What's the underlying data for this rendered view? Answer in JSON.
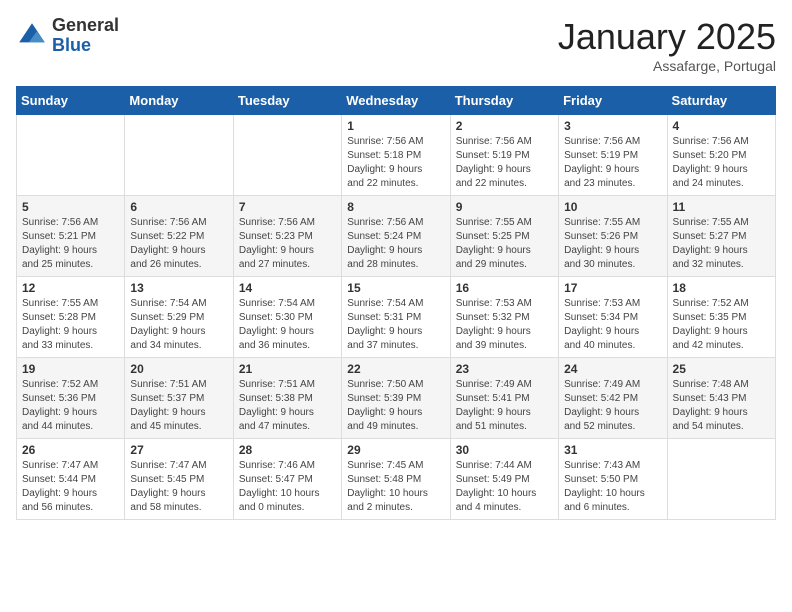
{
  "header": {
    "logo_general": "General",
    "logo_blue": "Blue",
    "month_title": "January 2025",
    "location": "Assafarge, Portugal"
  },
  "weekdays": [
    "Sunday",
    "Monday",
    "Tuesday",
    "Wednesday",
    "Thursday",
    "Friday",
    "Saturday"
  ],
  "weeks": [
    [
      {
        "day": "",
        "info": ""
      },
      {
        "day": "",
        "info": ""
      },
      {
        "day": "",
        "info": ""
      },
      {
        "day": "1",
        "info": "Sunrise: 7:56 AM\nSunset: 5:18 PM\nDaylight: 9 hours\nand 22 minutes."
      },
      {
        "day": "2",
        "info": "Sunrise: 7:56 AM\nSunset: 5:19 PM\nDaylight: 9 hours\nand 22 minutes."
      },
      {
        "day": "3",
        "info": "Sunrise: 7:56 AM\nSunset: 5:19 PM\nDaylight: 9 hours\nand 23 minutes."
      },
      {
        "day": "4",
        "info": "Sunrise: 7:56 AM\nSunset: 5:20 PM\nDaylight: 9 hours\nand 24 minutes."
      }
    ],
    [
      {
        "day": "5",
        "info": "Sunrise: 7:56 AM\nSunset: 5:21 PM\nDaylight: 9 hours\nand 25 minutes."
      },
      {
        "day": "6",
        "info": "Sunrise: 7:56 AM\nSunset: 5:22 PM\nDaylight: 9 hours\nand 26 minutes."
      },
      {
        "day": "7",
        "info": "Sunrise: 7:56 AM\nSunset: 5:23 PM\nDaylight: 9 hours\nand 27 minutes."
      },
      {
        "day": "8",
        "info": "Sunrise: 7:56 AM\nSunset: 5:24 PM\nDaylight: 9 hours\nand 28 minutes."
      },
      {
        "day": "9",
        "info": "Sunrise: 7:55 AM\nSunset: 5:25 PM\nDaylight: 9 hours\nand 29 minutes."
      },
      {
        "day": "10",
        "info": "Sunrise: 7:55 AM\nSunset: 5:26 PM\nDaylight: 9 hours\nand 30 minutes."
      },
      {
        "day": "11",
        "info": "Sunrise: 7:55 AM\nSunset: 5:27 PM\nDaylight: 9 hours\nand 32 minutes."
      }
    ],
    [
      {
        "day": "12",
        "info": "Sunrise: 7:55 AM\nSunset: 5:28 PM\nDaylight: 9 hours\nand 33 minutes."
      },
      {
        "day": "13",
        "info": "Sunrise: 7:54 AM\nSunset: 5:29 PM\nDaylight: 9 hours\nand 34 minutes."
      },
      {
        "day": "14",
        "info": "Sunrise: 7:54 AM\nSunset: 5:30 PM\nDaylight: 9 hours\nand 36 minutes."
      },
      {
        "day": "15",
        "info": "Sunrise: 7:54 AM\nSunset: 5:31 PM\nDaylight: 9 hours\nand 37 minutes."
      },
      {
        "day": "16",
        "info": "Sunrise: 7:53 AM\nSunset: 5:32 PM\nDaylight: 9 hours\nand 39 minutes."
      },
      {
        "day": "17",
        "info": "Sunrise: 7:53 AM\nSunset: 5:34 PM\nDaylight: 9 hours\nand 40 minutes."
      },
      {
        "day": "18",
        "info": "Sunrise: 7:52 AM\nSunset: 5:35 PM\nDaylight: 9 hours\nand 42 minutes."
      }
    ],
    [
      {
        "day": "19",
        "info": "Sunrise: 7:52 AM\nSunset: 5:36 PM\nDaylight: 9 hours\nand 44 minutes."
      },
      {
        "day": "20",
        "info": "Sunrise: 7:51 AM\nSunset: 5:37 PM\nDaylight: 9 hours\nand 45 minutes."
      },
      {
        "day": "21",
        "info": "Sunrise: 7:51 AM\nSunset: 5:38 PM\nDaylight: 9 hours\nand 47 minutes."
      },
      {
        "day": "22",
        "info": "Sunrise: 7:50 AM\nSunset: 5:39 PM\nDaylight: 9 hours\nand 49 minutes."
      },
      {
        "day": "23",
        "info": "Sunrise: 7:49 AM\nSunset: 5:41 PM\nDaylight: 9 hours\nand 51 minutes."
      },
      {
        "day": "24",
        "info": "Sunrise: 7:49 AM\nSunset: 5:42 PM\nDaylight: 9 hours\nand 52 minutes."
      },
      {
        "day": "25",
        "info": "Sunrise: 7:48 AM\nSunset: 5:43 PM\nDaylight: 9 hours\nand 54 minutes."
      }
    ],
    [
      {
        "day": "26",
        "info": "Sunrise: 7:47 AM\nSunset: 5:44 PM\nDaylight: 9 hours\nand 56 minutes."
      },
      {
        "day": "27",
        "info": "Sunrise: 7:47 AM\nSunset: 5:45 PM\nDaylight: 9 hours\nand 58 minutes."
      },
      {
        "day": "28",
        "info": "Sunrise: 7:46 AM\nSunset: 5:47 PM\nDaylight: 10 hours\nand 0 minutes."
      },
      {
        "day": "29",
        "info": "Sunrise: 7:45 AM\nSunset: 5:48 PM\nDaylight: 10 hours\nand 2 minutes."
      },
      {
        "day": "30",
        "info": "Sunrise: 7:44 AM\nSunset: 5:49 PM\nDaylight: 10 hours\nand 4 minutes."
      },
      {
        "day": "31",
        "info": "Sunrise: 7:43 AM\nSunset: 5:50 PM\nDaylight: 10 hours\nand 6 minutes."
      },
      {
        "day": "",
        "info": ""
      }
    ]
  ]
}
